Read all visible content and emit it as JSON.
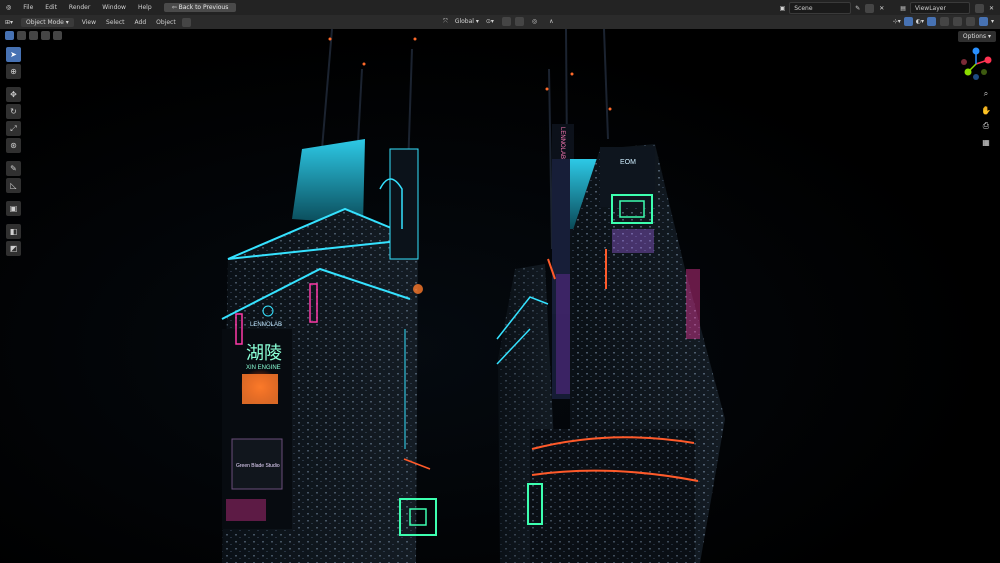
{
  "menubar": {
    "menus": [
      "File",
      "Edit",
      "Render",
      "Window",
      "Help"
    ],
    "back_button": "Back to Previous",
    "scene_label": "Scene",
    "viewlayer_label": "ViewLayer"
  },
  "header": {
    "mode": "Object Mode",
    "menus": [
      "View",
      "Select",
      "Add",
      "Object"
    ],
    "transform_orientation": "Global",
    "options": "Options"
  },
  "tools": [
    "select-box",
    "cursor",
    "move",
    "rotate",
    "scale",
    "transform",
    "annotate",
    "measure",
    "add-cube",
    "extrude",
    "inset"
  ],
  "scene": {
    "left_tower": {
      "brand": "LENNOLAB",
      "sign_chinese": "湖陵",
      "sign_engine": "XIN ENGINE",
      "sign_bottom": "Green Blade Studio"
    },
    "right_tower": {
      "brand_vertical": "LENNOLAB",
      "rooftop_logo": "EOM"
    }
  },
  "colors": {
    "accent": "#4772b3",
    "neon_cyan": "#35e2ff",
    "neon_orange": "#ff5a2a",
    "neon_pink": "#ff3aa8",
    "neon_green": "#3dffb0"
  }
}
